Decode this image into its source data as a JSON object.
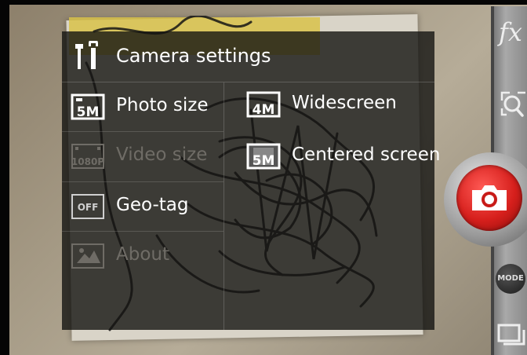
{
  "menu": {
    "title": "Camera settings",
    "items": [
      {
        "label": "Photo size",
        "icon_text": "5M",
        "enabled": true
      },
      {
        "label": "Video size",
        "icon_text": "1080P",
        "enabled": false
      },
      {
        "label": "Geo-tag",
        "icon_text": "OFF",
        "enabled": true
      },
      {
        "label": "About",
        "icon_text": "",
        "enabled": false
      }
    ],
    "photo_size_options": [
      {
        "label": "Widescreen",
        "icon_text": "4M"
      },
      {
        "label": "Centered screen",
        "icon_text": "5M"
      }
    ]
  },
  "controls": {
    "fx_label": "fx",
    "mode_label": "MODE"
  },
  "icons": {
    "header": "wrench-screwdriver-icon",
    "photo_size": "photo-size-5m-icon",
    "video_size": "video-size-1080p-icon",
    "geo_tag": "geo-tag-off-icon",
    "about": "about-icon",
    "zoom": "zoom-icon",
    "shutter": "camera-icon",
    "gallery": "gallery-icon"
  },
  "colors": {
    "shutter_red": "#d61f1c",
    "menu_bg": "#141412",
    "disabled_text": "#6f6c66"
  }
}
